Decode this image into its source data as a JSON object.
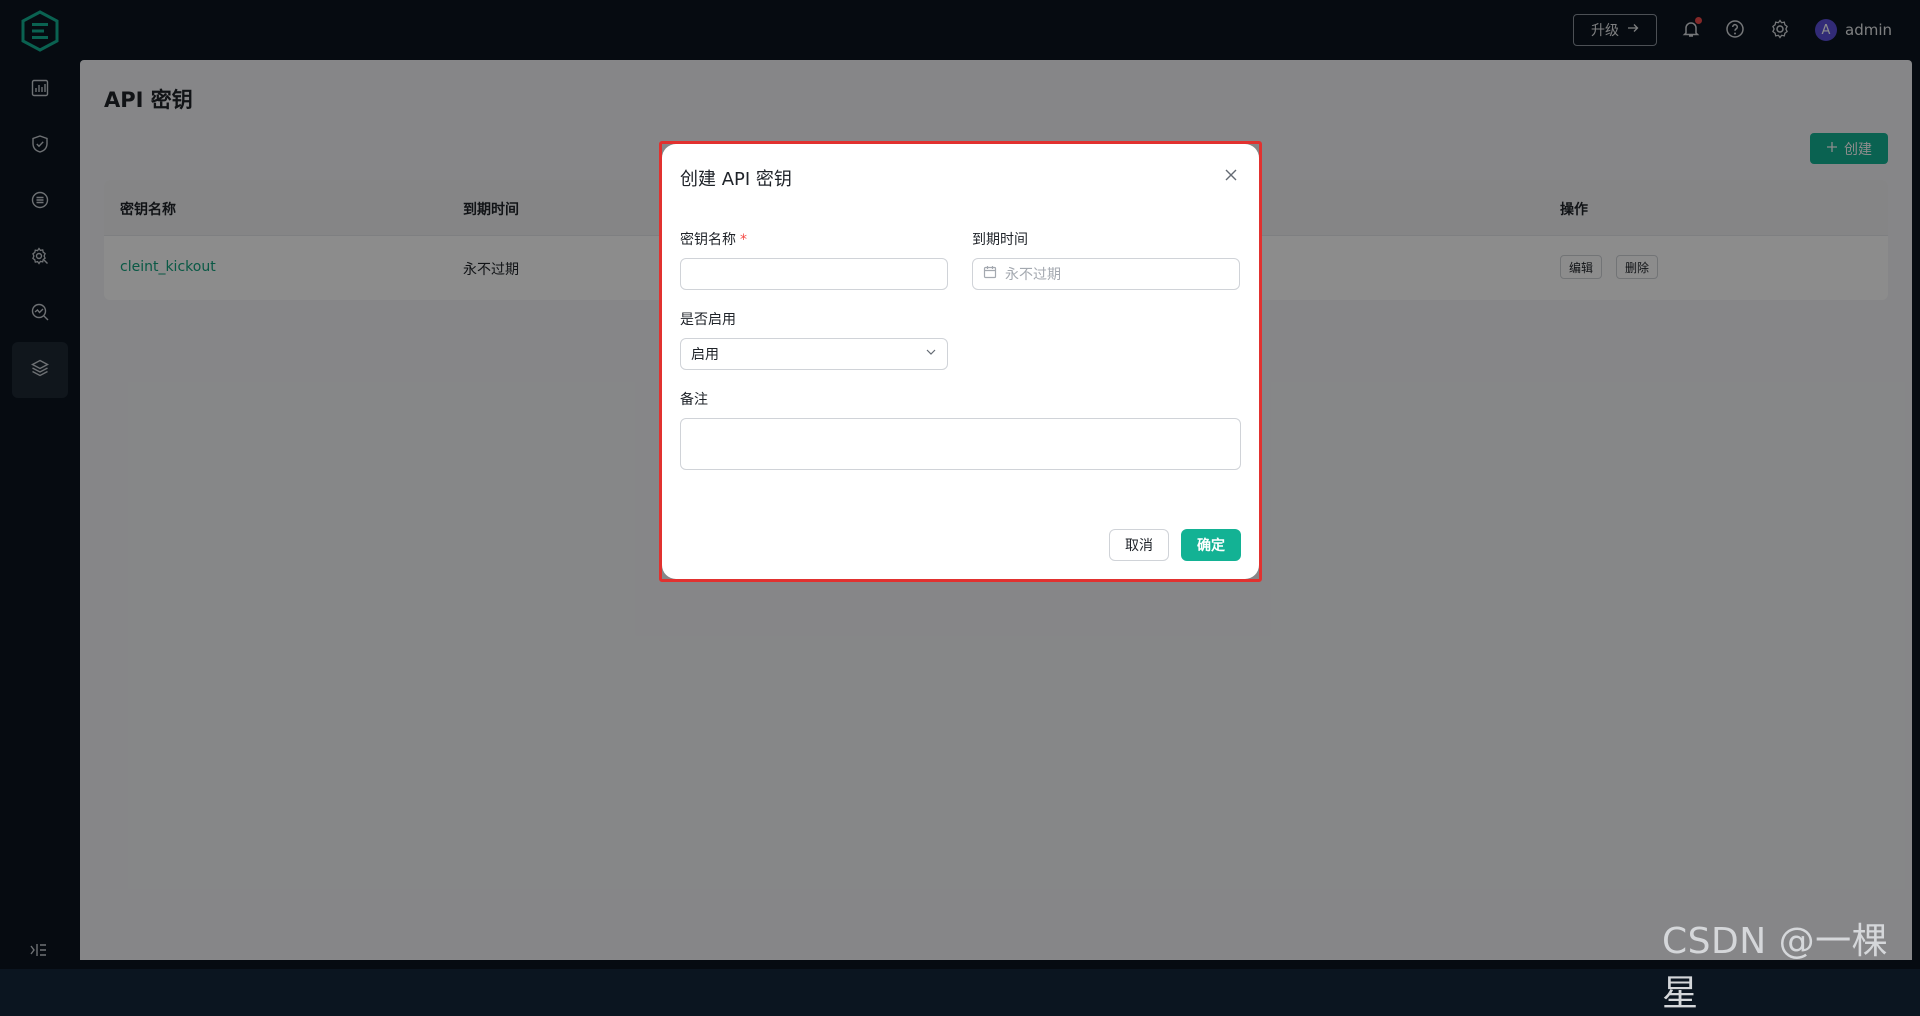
{
  "header": {
    "upgrade_label": "升级",
    "user_initial": "A",
    "user_name": "admin"
  },
  "sidebar": {
    "items": [
      {
        "icon": "dashboard-icon"
      },
      {
        "icon": "shield-icon"
      },
      {
        "icon": "list-icon"
      },
      {
        "icon": "settings-icon"
      },
      {
        "icon": "search-chart-icon"
      },
      {
        "icon": "layers-icon",
        "active": true
      }
    ],
    "collapse_icon": "collapse-icon"
  },
  "page": {
    "title": "API 密钥",
    "create_label": "创建",
    "table": {
      "columns": [
        "密钥名称",
        "到期时间",
        "操作"
      ],
      "rows": [
        {
          "name": "cleint_kickout",
          "expiry": "永不过期",
          "actions": [
            "编辑",
            "删除"
          ]
        }
      ]
    }
  },
  "modal": {
    "title": "创建 API 密钥",
    "fields": {
      "name_label": "密钥名称",
      "required_mark": "*",
      "expiry_label": "到期时间",
      "expiry_placeholder": "永不过期",
      "enabled_label": "是否启用",
      "enabled_value": "启用",
      "remark_label": "备注"
    },
    "cancel_label": "取消",
    "ok_label": "确定"
  },
  "watermark": "CSDN @一棵星",
  "colors": {
    "accent": "#13b294",
    "danger": "#e1312f",
    "link": "#13a37f"
  }
}
